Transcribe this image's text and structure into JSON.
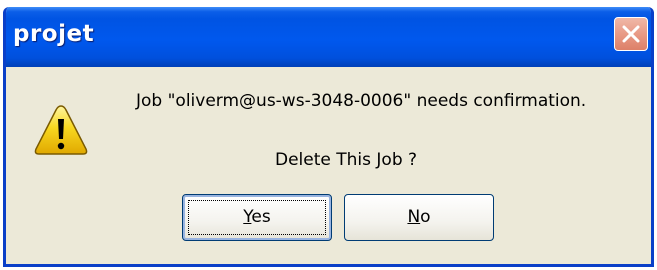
{
  "window": {
    "title": "projet"
  },
  "icons": {
    "warning": "warning-icon",
    "close": "close-icon"
  },
  "message": {
    "line1": "Job \"oliverm@us-ws-3048-0006\" needs confirmation.",
    "line2": "Delete This Job ?"
  },
  "buttons": {
    "yes_mnemonic": "Y",
    "yes_rest": "es",
    "no_mnemonic": "N",
    "no_rest": "o"
  },
  "colors": {
    "titlebar": "#0054e3",
    "frame": "#0a3fc8",
    "face": "#ece9d8",
    "close": "#e89a86"
  }
}
